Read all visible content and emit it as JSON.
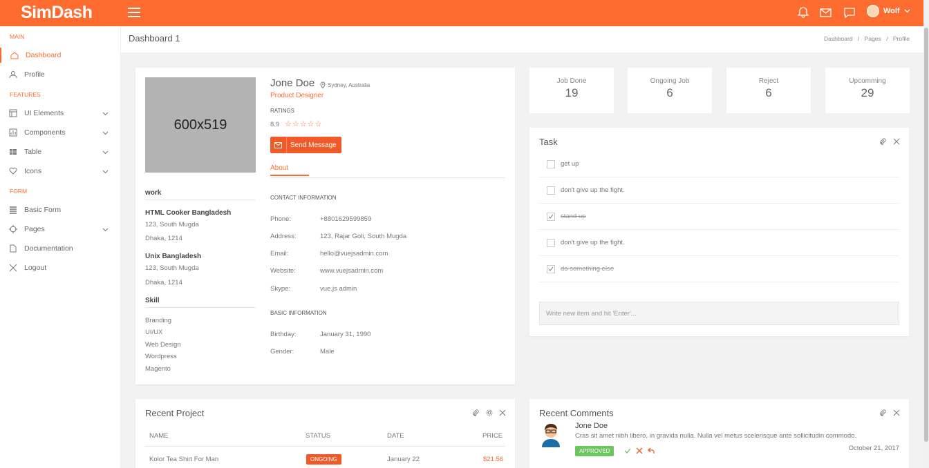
{
  "topbar": {
    "logo": "SimDash",
    "user_name": "Wolf"
  },
  "sidebar": {
    "sections": [
      "MAIN",
      "FEATURES",
      "FORM"
    ],
    "items": [
      {
        "label": "Dashboard"
      },
      {
        "label": "Profile"
      },
      {
        "label": "UI Elements"
      },
      {
        "label": "Components"
      },
      {
        "label": "Table"
      },
      {
        "label": "Icons"
      },
      {
        "label": "Basic Form"
      },
      {
        "label": "Pages"
      },
      {
        "label": "Documentation"
      },
      {
        "label": "Logout"
      }
    ]
  },
  "header": {
    "title": "Dashboard 1",
    "breadcrumb": [
      "Dashboard",
      "Pages",
      "Profile"
    ],
    "sep": "/"
  },
  "profile": {
    "photo_label": "600x519",
    "name": "Jone Doe",
    "location": "Sydney, Australia",
    "role": "Product Designer",
    "ratings_label": "RATINGS",
    "rating": "8.9",
    "stars": "☆☆☆☆☆",
    "button": "Send Message",
    "tab": "About",
    "work_title": "work",
    "works": [
      {
        "name": "HTML Cooker Bangladesh",
        "line1": "123, South Mugda",
        "line2": "Dhaka, 1214"
      },
      {
        "name": "Unix Bangladesh",
        "line1": "123, South Mugda",
        "line2": "Dhaka, 1214"
      }
    ],
    "skill_title": "Skill",
    "skills": [
      "Branding",
      "UI/UX",
      "Web Design",
      "Wordpress",
      "Magento"
    ],
    "contact_title": "CONTACT INFORMATION",
    "contact": [
      {
        "k": "Phone:",
        "v": "+8801629599859"
      },
      {
        "k": "Address:",
        "v": "123, Rajar Goli, South Mugda"
      },
      {
        "k": "Email:",
        "v": "hello@vuejsadmin.com"
      },
      {
        "k": "Website:",
        "v": "www.vuejsadmin.com"
      },
      {
        "k": "Skype:",
        "v": "vue.js admin"
      }
    ],
    "basic_title": "BASIC INFORMATION",
    "basic": [
      {
        "k": "Birthday:",
        "v": "January 31, 1990"
      },
      {
        "k": "Gender:",
        "v": "Male"
      }
    ]
  },
  "stats": [
    {
      "label": "Job Done",
      "value": "19"
    },
    {
      "label": "Ongoing Job",
      "value": "6"
    },
    {
      "label": "Reject",
      "value": "6"
    },
    {
      "label": "Upcomming",
      "value": "29"
    }
  ],
  "task": {
    "title": "Task",
    "items": [
      {
        "text": "get up",
        "done": false
      },
      {
        "text": "don't give up the fight.",
        "done": false
      },
      {
        "text": "stand up",
        "done": true
      },
      {
        "text": "don't give up the fight.",
        "done": false
      },
      {
        "text": "do something else",
        "done": true
      }
    ],
    "placeholder": "Write new item and hit 'Enter'..."
  },
  "project": {
    "title": "Recent Project",
    "headers": [
      "NAME",
      "STATUS",
      "DATE",
      "PRICE"
    ],
    "rows": [
      {
        "name": "Kolor Tea Shirt For Man",
        "status": "ONGOING",
        "date": "January 22",
        "price": "$21.56"
      }
    ]
  },
  "comments": {
    "title": "Recent Comments",
    "items": [
      {
        "name": "Jone Doe",
        "text": "Cras sit amet nibh libero, in gravida nulla. Nulla vel metus scelerisque ante sollicitudin commodo.",
        "badge": "APPROVED",
        "date": "October 21, 2017"
      }
    ]
  },
  "colors": {
    "accent": "#fd6b2f",
    "approved": "#6cc55f"
  }
}
